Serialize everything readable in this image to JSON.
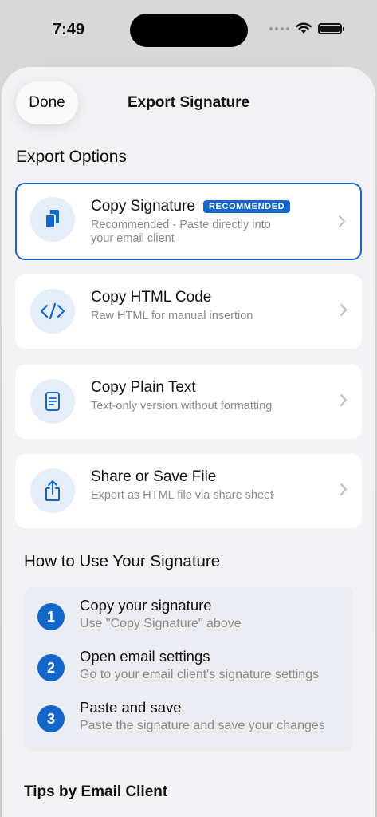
{
  "status_bar": {
    "time": "7:49"
  },
  "nav": {
    "done_label": "Done",
    "title": "Export Signature"
  },
  "export_options": {
    "heading": "Export Options",
    "items": [
      {
        "title": "Copy Signature",
        "badge": "RECOMMENDED",
        "subtitle_line1": "Recommended - Paste directly into",
        "subtitle_line2": "your email client",
        "icon": "copy-doc-icon",
        "selected": true
      },
      {
        "title": "Copy HTML Code",
        "subtitle": "Raw HTML for manual insertion",
        "icon": "code-icon"
      },
      {
        "title": "Copy Plain Text",
        "subtitle": "Text-only version without formatting",
        "icon": "document-text-icon"
      },
      {
        "title": "Share or Save File",
        "subtitle": "Export as HTML file via share sheet",
        "icon": "share-icon"
      }
    ]
  },
  "how_to": {
    "heading": "How to Use Your Signature",
    "steps": [
      {
        "number": "1",
        "title": "Copy your signature",
        "subtitle": "Use \"Copy Signature\" above"
      },
      {
        "number": "2",
        "title": "Open email settings",
        "subtitle": "Go to your email client's signature settings"
      },
      {
        "number": "3",
        "title": "Paste and save",
        "subtitle": "Paste the signature and save your changes"
      }
    ]
  },
  "tips": {
    "heading": "Tips by Email Client"
  },
  "colors": {
    "accent": "#1466c8",
    "icon_bg": "#e4edf8",
    "sheet_bg": "#f2f2f4"
  }
}
